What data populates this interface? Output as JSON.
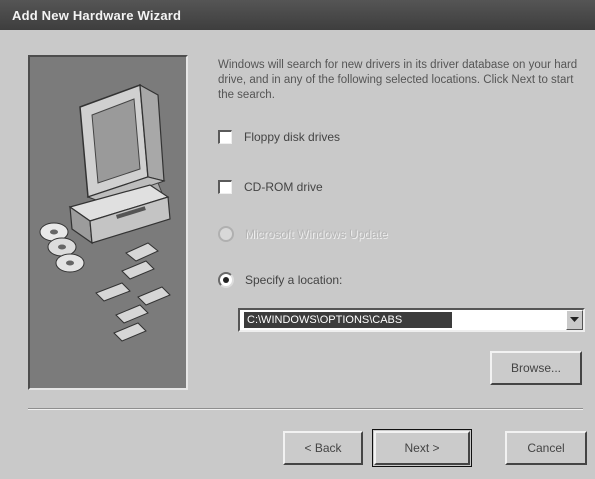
{
  "window": {
    "title": "Add New Hardware Wizard"
  },
  "instructions": "Windows will search for new drivers in its driver database on your hard drive, and in any of the following selected locations. Click Next to start the search.",
  "options": [
    {
      "label": "Floppy disk drives",
      "checked": false,
      "enabled": true
    },
    {
      "label": "CD-ROM drive",
      "checked": false,
      "enabled": true
    },
    {
      "label": "Microsoft Windows Update",
      "checked": false,
      "enabled": false
    },
    {
      "label": "Specify a location:",
      "checked": true,
      "enabled": true
    }
  ],
  "location": {
    "value": "C:\\WINDOWS\\OPTIONS\\CABS"
  },
  "buttons": {
    "browse": "Browse...",
    "back": "< Back",
    "next": "Next >",
    "cancel": "Cancel"
  },
  "colors": {
    "titlebar": "#444444",
    "dialog": "#c9c9c9",
    "artwork_bg": "#7b7b7b"
  },
  "icons": [
    "computer-icon",
    "cd-disc-icon",
    "chevron-down-icon"
  ]
}
